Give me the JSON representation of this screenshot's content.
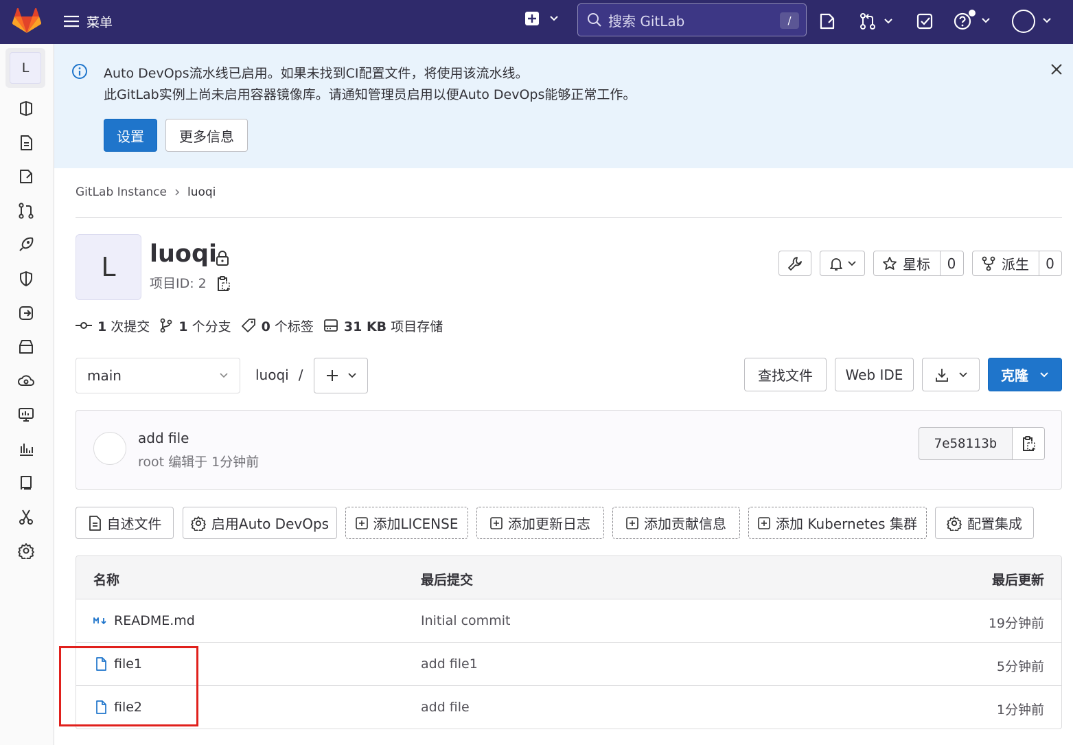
{
  "navbar": {
    "menu_label": "菜单",
    "search_placeholder": "搜索 GitLab",
    "search_shortcut": "/"
  },
  "sidebar": {
    "project_letter": "L",
    "items": [
      "project-overview-icon",
      "repository-icon",
      "issues-icon",
      "merge-requests-icon",
      "cicd-icon",
      "security-icon",
      "deployments-icon",
      "packages-icon",
      "infrastructure-icon",
      "monitor-icon",
      "analytics-icon",
      "wiki-icon",
      "snippets-icon",
      "settings-icon"
    ]
  },
  "alert": {
    "line1": "Auto DevOps流水线已启用。如果未找到CI配置文件，将使用该流水线。",
    "line2": "此GitLab实例上尚未启用容器镜像库。请通知管理员启用以便Auto DevOps能够正常工作。",
    "settings_button": "设置",
    "more_info_button": "更多信息"
  },
  "breadcrumb": {
    "parent": "GitLab Instance",
    "current": "luoqi"
  },
  "project": {
    "avatar_letter": "L",
    "name": "luoqi",
    "id_label": "项目ID: 2",
    "star_label": "星标",
    "star_count": "0",
    "fork_label": "派生",
    "fork_count": "0"
  },
  "stats": {
    "commits_num": "1",
    "commits_label": "次提交",
    "branches_num": "1",
    "branches_label": "个分支",
    "tags_num": "0",
    "tags_label": "个标签",
    "storage_num": "31 KB",
    "storage_label": "项目存储"
  },
  "toolbar": {
    "branch": "main",
    "path_root": "luoqi",
    "path_sep": "/",
    "find_file": "查找文件",
    "web_ide": "Web IDE",
    "clone": "克隆"
  },
  "last_commit": {
    "title": "add file",
    "subtitle": "root 编辑于 1分钟前",
    "sha": "7e58113b"
  },
  "quick_actions": [
    "自述文件",
    "启用Auto DevOps",
    "添加LICENSE",
    "添加更新日志",
    "添加贡献信息",
    "添加 Kubernetes 集群",
    "配置集成"
  ],
  "files": {
    "headers": {
      "name": "名称",
      "last_commit": "最后提交",
      "last_update": "最后更新"
    },
    "rows": [
      {
        "name": "README.md",
        "commit": "Initial commit",
        "updated": "19分钟前",
        "icon": "markdown-icon"
      },
      {
        "name": "file1",
        "commit": "add file1",
        "updated": "5分钟前",
        "icon": "file-icon"
      },
      {
        "name": "file2",
        "commit": "add file",
        "updated": "1分钟前",
        "icon": "file-icon"
      }
    ]
  },
  "colors": {
    "navbar": "#2f2a6b",
    "primary": "#1f75cb",
    "alert_bg": "#e9f3fc",
    "highlight": "#e0201c"
  }
}
